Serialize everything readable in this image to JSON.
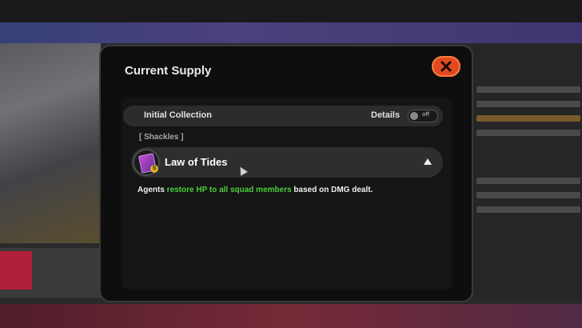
{
  "dialog": {
    "title": "Current Supply",
    "close_icon": "close-x-icon"
  },
  "collection": {
    "label": "Initial Collection",
    "details_label": "Details",
    "toggle_state": "off"
  },
  "category": {
    "label": "[ Shackles ]"
  },
  "item": {
    "name": "Law of Tides",
    "icon": "card-icon",
    "badge": "S",
    "expanded_icon": "triangle-up-icon",
    "description_prefix": "Agents ",
    "description_highlight": "restore HP to all squad members",
    "description_suffix": " based on DMG dealt."
  },
  "colors": {
    "close_button": "#e04a20",
    "highlight_text": "#4ccf3a",
    "panel_bg": "#0e0e0f"
  }
}
